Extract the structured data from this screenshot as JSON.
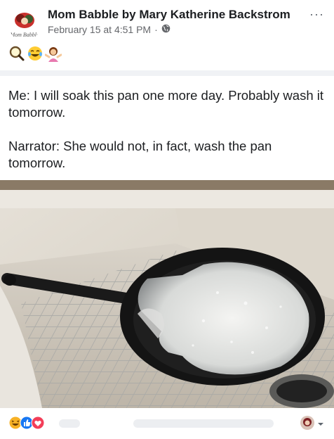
{
  "post": {
    "author": "Mom Babble by Mary Katherine Backstrom",
    "timestamp": "February 15 at 4:51 PM",
    "separator": "·",
    "privacy_icon": "globe-icon",
    "more_label": "···",
    "logo_text": "Mom Babble",
    "header_emojis": [
      "magnifying-glass-icon",
      "laughing-crying-emoji",
      "woman-shrugging-emoji"
    ],
    "caption": [
      "Me: I will soak this pan one more day. Probably wash it tomorrow.",
      "Narrator: She would not, in fact, wash the pan tomorrow."
    ],
    "photo_alt": "Cast iron skillet soaking with soapy water in a white farmhouse sink on a wire rack"
  },
  "footer": {
    "reaction_icons": [
      "haha-reaction-icon",
      "like-reaction-icon",
      "love-reaction-icon"
    ],
    "viewer_avatar": "viewer-avatar",
    "dropdown_icon": "caret-down-icon"
  },
  "colors": {
    "facebook_blue": "#1877f2",
    "love_red": "#f33e58",
    "haha_yellow": "#f7b125",
    "muted_text": "#65676b"
  }
}
